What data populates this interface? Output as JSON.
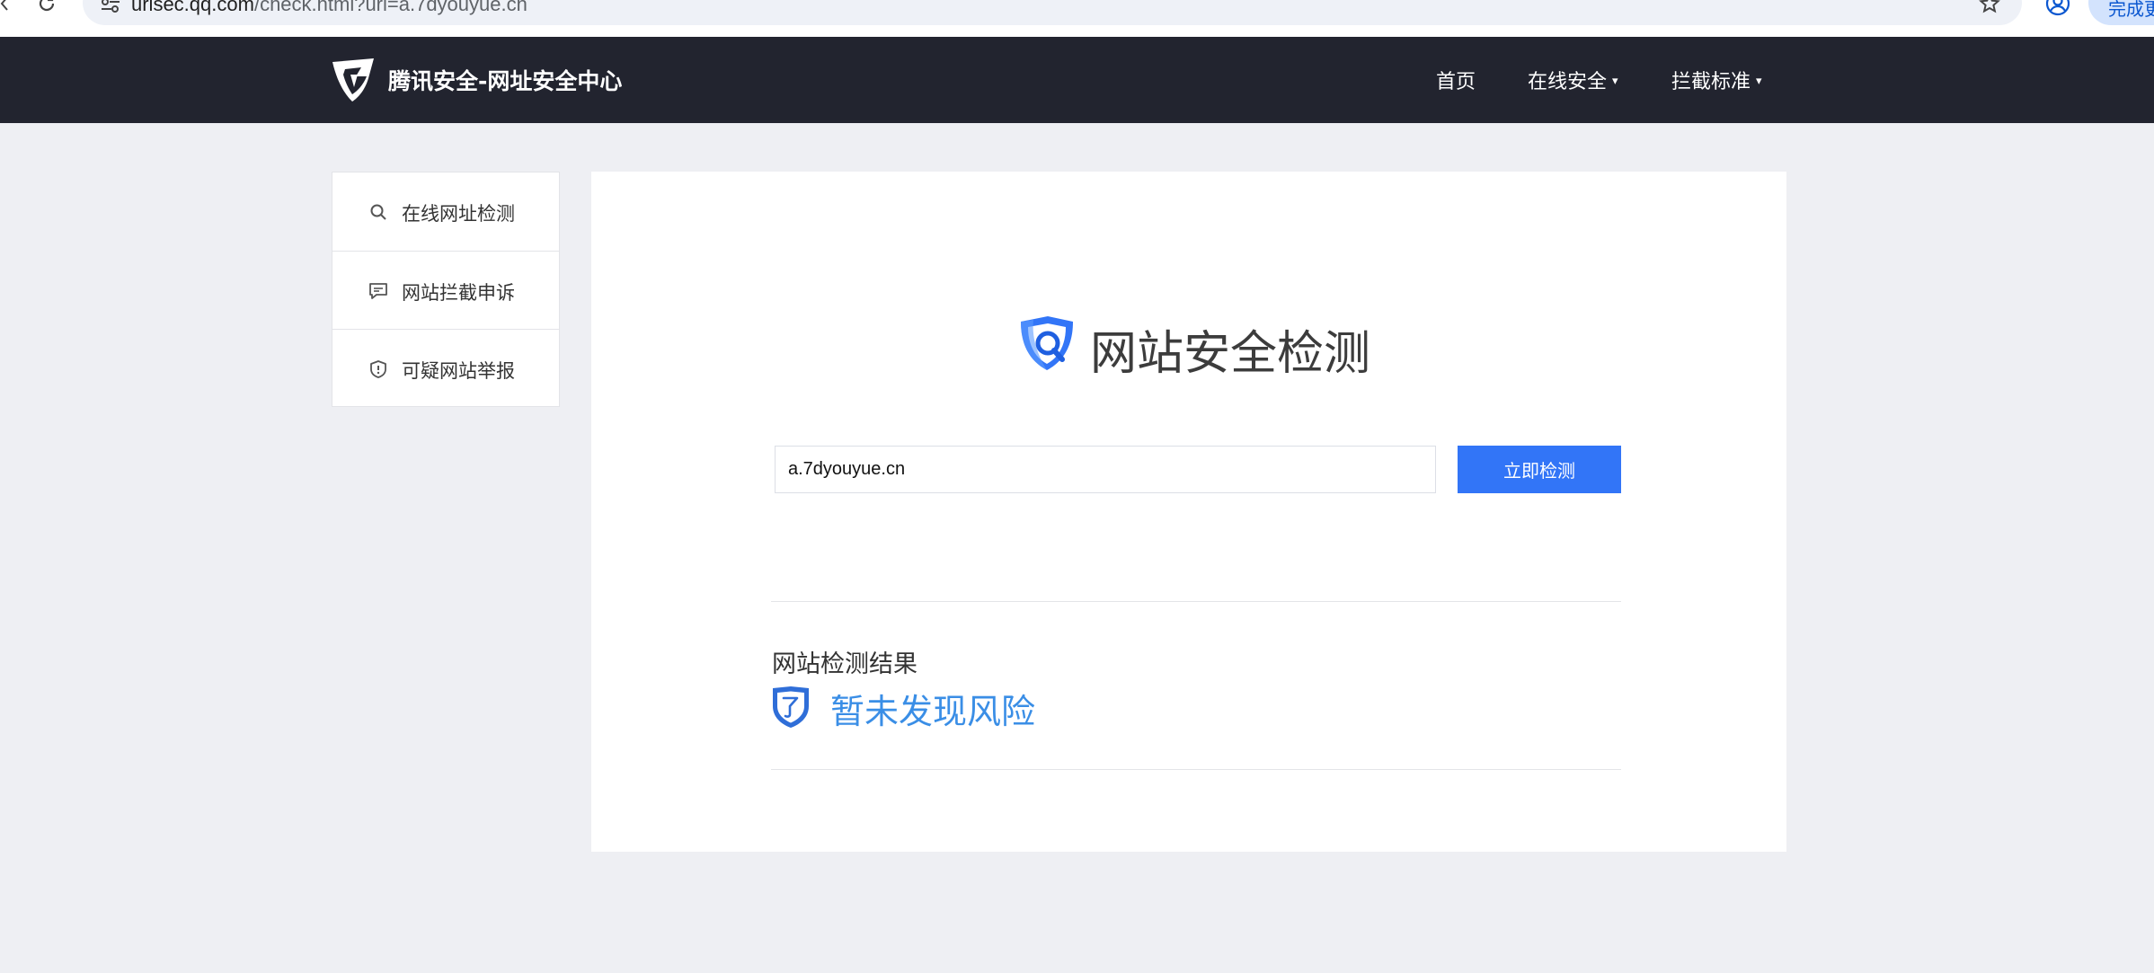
{
  "browser": {
    "url_host": "urlsec.qq.com",
    "url_path": "/check.html?url=a.7dyouyue.cn",
    "action_label": "完成更新"
  },
  "header": {
    "brand": "腾讯安全-网址安全中心",
    "nav": [
      {
        "label": "首页",
        "has_dropdown": false
      },
      {
        "label": "在线安全",
        "has_dropdown": true
      },
      {
        "label": "拦截标准",
        "has_dropdown": true
      }
    ],
    "caret": "▾"
  },
  "sidebar": {
    "items": [
      {
        "label": "在线网址检测",
        "icon": "search-icon"
      },
      {
        "label": "网站拦截申诉",
        "icon": "chat-icon"
      },
      {
        "label": "可疑网站举报",
        "icon": "shield-alert-icon"
      }
    ]
  },
  "main": {
    "title": "网站安全检测",
    "search": {
      "value": "a.7dyouyue.cn",
      "button_label": "立即检测"
    },
    "result": {
      "heading": "网站检测结果",
      "status": "暂未发现风险",
      "status_color": "#3a8ee6"
    }
  },
  "colors": {
    "header_bg": "#22242f",
    "accent": "#3275f7",
    "page_bg": "#eeeff3"
  }
}
